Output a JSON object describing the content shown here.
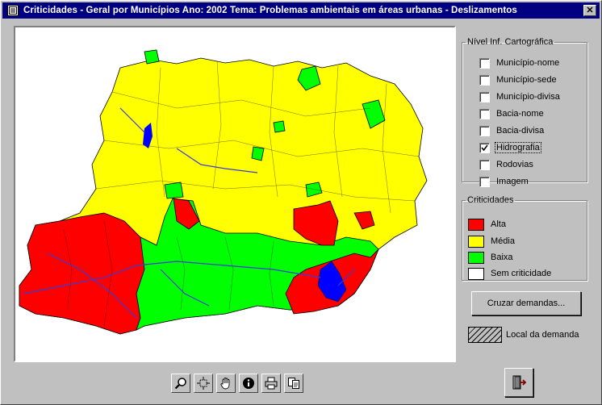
{
  "window": {
    "title": "Criticidades - Geral por Municípios  Ano: 2002  Tema: Problemas ambientais em áreas urbanas - Deslizamentos",
    "close_label": "✕"
  },
  "layers": {
    "legend": "Nível  Inf. Cartográfica",
    "items": [
      {
        "label": "Município-nome",
        "checked": false
      },
      {
        "label": "Município-sede",
        "checked": false
      },
      {
        "label": "Município-divisa",
        "checked": false
      },
      {
        "label": "Bacia-nome",
        "checked": false
      },
      {
        "label": "Bacia-divisa",
        "checked": false
      },
      {
        "label": "Hidrografia",
        "checked": true
      },
      {
        "label": "Rodovias",
        "checked": false
      },
      {
        "label": "Imagem",
        "checked": false
      }
    ]
  },
  "criticidades": {
    "legend": "Criticidades",
    "items": [
      {
        "label": "Alta",
        "color": "#ff0000"
      },
      {
        "label": "Média",
        "color": "#ffff00"
      },
      {
        "label": "Baixa",
        "color": "#00ff00"
      },
      {
        "label": "Sem criticidade",
        "color": "#ffffff"
      }
    ]
  },
  "buttons": {
    "cruzar": "Cruzar demandas..."
  },
  "local_demanda": "Local da demanda",
  "toolbar": [
    {
      "name": "zoom-icon"
    },
    {
      "name": "extent-icon"
    },
    {
      "name": "pan-hand-icon"
    },
    {
      "name": "info-icon"
    },
    {
      "name": "print-icon"
    },
    {
      "name": "copy-icon"
    }
  ],
  "colors": {
    "titlebar": "#000080",
    "alta": "#ff0000",
    "media": "#ffff00",
    "baixa": "#00ff00",
    "water": "#0000ff",
    "rivers": "#3b3bd8"
  }
}
